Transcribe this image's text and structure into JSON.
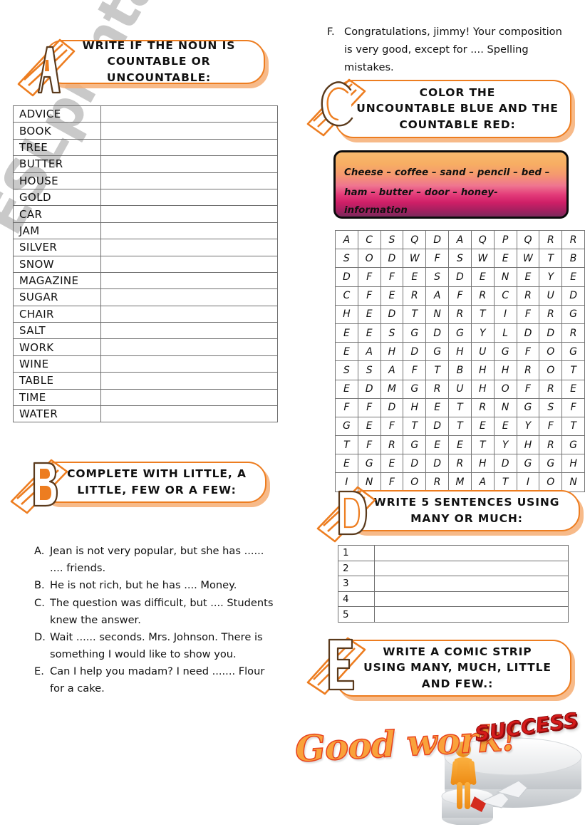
{
  "watermark": {
    "text": "ESLprintables.com"
  },
  "sections": {
    "a": {
      "badge_letter": "A",
      "title_line1": "WRITE IF THE NOUN IS",
      "title_line2": "COUNTABLE OR UNCOUNTABLE:",
      "words": [
        "ADVICE",
        "BOOK",
        "TREE",
        "BUTTER",
        "HOUSE",
        "GOLD",
        "CAR",
        "JAM",
        "SILVER",
        "SNOW",
        "MAGAZINE",
        "SUGAR",
        "CHAIR",
        "SALT",
        "WORK",
        "WINE",
        "TABLE",
        "TIME",
        "WATER"
      ]
    },
    "b": {
      "badge_letter": "B",
      "title_line1": "COMPLETE WITH LITTLE, A",
      "title_line2": "LITTLE, FEW OR A FEW:",
      "items": [
        {
          "letter": "A.",
          "text": "Jean is not very popular, but she has ......  .... friends."
        },
        {
          "letter": "B.",
          "text": "He is not rich, but he has .... Money."
        },
        {
          "letter": "C.",
          "text": "The question was difficult, but .... Students knew the answer."
        },
        {
          "letter": "D.",
          "text": "Wait ...... seconds. Mrs. Johnson. There is  something I would like to show you."
        },
        {
          "letter": "E.",
          "text": "Can I help you madam? I need ....... Flour for a cake."
        }
      ]
    },
    "f": {
      "letter": "F.",
      "text": "Congratulations, jimmy! Your composition is very good, except for .... Spelling mistakes."
    },
    "c": {
      "badge_letter": "C",
      "title_line1": "COLOR THE",
      "title_line2": "UNCOUNTABLE BLUE AND THE",
      "title_line3": "COUNTABLE RED:",
      "word_box_line1": "Cheese – coffee – sand – pencil – bed –",
      "word_box_line2": "ham – butter – door – honey- information",
      "word_box_colors": {
        "top": "#f7b96e",
        "middle": "#e33b79",
        "bottom": "#7d2a5c",
        "border": "#0b0b0b"
      }
    },
    "wordsearch": {
      "rows": [
        [
          "A",
          "C",
          "S",
          "Q",
          "D",
          "A",
          "Q",
          "P",
          "Q",
          "R",
          "R"
        ],
        [
          "S",
          "O",
          "D",
          "W",
          "F",
          "S",
          "W",
          "E",
          "W",
          "T",
          "B"
        ],
        [
          "D",
          "F",
          "F",
          "E",
          "S",
          "D",
          "E",
          "N",
          "E",
          "Y",
          "E"
        ],
        [
          "C",
          "F",
          "E",
          "R",
          "A",
          "F",
          "R",
          "C",
          "R",
          "U",
          "D"
        ],
        [
          "H",
          "E",
          "D",
          "T",
          "N",
          "R",
          "T",
          "I",
          "F",
          "R",
          "G"
        ],
        [
          "E",
          "E",
          "S",
          "G",
          "D",
          "G",
          "Y",
          "L",
          "D",
          "D",
          "R"
        ],
        [
          "E",
          "A",
          "H",
          "D",
          "G",
          "H",
          "U",
          "G",
          "F",
          "O",
          "G"
        ],
        [
          "S",
          "S",
          "A",
          "F",
          "T",
          "B",
          "H",
          "H",
          "R",
          "O",
          "T"
        ],
        [
          "E",
          "D",
          "M",
          "G",
          "R",
          "U",
          "H",
          "O",
          "F",
          "R",
          "E"
        ],
        [
          "F",
          "F",
          "D",
          "H",
          "E",
          "T",
          "R",
          "N",
          "G",
          "S",
          "F"
        ],
        [
          "G",
          "E",
          "F",
          "T",
          "D",
          "T",
          "E",
          "E",
          "Y",
          "F",
          "T"
        ],
        [
          "T",
          "F",
          "R",
          "G",
          "E",
          "E",
          "T",
          "Y",
          "H",
          "R",
          "G"
        ],
        [
          "E",
          "G",
          "E",
          "D",
          "D",
          "R",
          "H",
          "D",
          "G",
          "G",
          "H"
        ],
        [
          "I",
          "N",
          "F",
          "O",
          "R",
          "M",
          "A",
          "T",
          "I",
          "O",
          "N"
        ]
      ]
    },
    "d": {
      "badge_letter": "D",
      "title_line1": "WRITE 5 SENTENCES USING",
      "title_line2": "MANY OR MUCH:",
      "numbers": [
        "1",
        "2",
        "3",
        "4",
        "5"
      ]
    },
    "e": {
      "badge_letter": "E",
      "title_line1": "WRITE A COMIC STRIP",
      "title_line2": "USING MANY, MUCH, LITTLE",
      "title_line3": "AND FEW.:"
    }
  },
  "footer": {
    "good_work": "Good work!",
    "success": "SUCCESS",
    "good_work_color": "#F9A23B",
    "success_color": "#D51B1B"
  },
  "theme": {
    "accent_orange": "#ED7D20",
    "accent_shadow": "#F6AE74",
    "table_border": "#6f6f6f"
  }
}
